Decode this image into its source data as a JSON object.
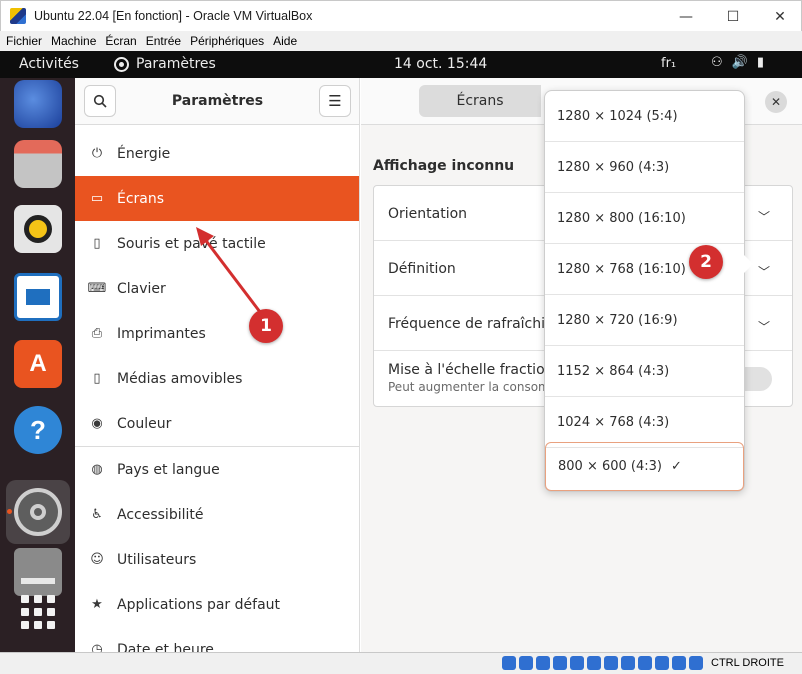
{
  "window": {
    "title": "Ubuntu 22.04 [En fonction] - Oracle VM VirtualBox",
    "minimize": "—",
    "maximize": "☐",
    "close": "✕"
  },
  "vbox_menu": [
    "Fichier",
    "Machine",
    "Écran",
    "Entrée",
    "Périphériques",
    "Aide"
  ],
  "topbar": {
    "activities": "Activités",
    "app": "Paramètres",
    "clock": "14 oct.  15:44",
    "keyboard": "fr₁"
  },
  "sidebar": {
    "title": "Paramètres",
    "items": [
      {
        "label": "Énergie",
        "icon": "power-icon"
      },
      {
        "label": "Écrans",
        "icon": "display-icon"
      },
      {
        "label": "Souris et pavé tactile",
        "icon": "mouse-icon"
      },
      {
        "label": "Clavier",
        "icon": "keyboard-icon"
      },
      {
        "label": "Imprimantes",
        "icon": "printer-icon"
      },
      {
        "label": "Médias amovibles",
        "icon": "usb-icon"
      },
      {
        "label": "Couleur",
        "icon": "color-icon"
      },
      {
        "label": "Pays et langue",
        "icon": "globe-icon"
      },
      {
        "label": "Accessibilité",
        "icon": "accessibility-icon"
      },
      {
        "label": "Utilisateurs",
        "icon": "users-icon"
      },
      {
        "label": "Applications par défaut",
        "icon": "star-icon"
      },
      {
        "label": "Date et heure",
        "icon": "clock-icon"
      }
    ]
  },
  "main": {
    "tab": "Écrans",
    "section_title": "Affichage inconnu",
    "rows": {
      "orientation": "Orientation",
      "definition": "Définition",
      "refresh": "Fréquence de rafraîchis",
      "scaling": "Mise à l'échelle fraction",
      "scaling_sub": "Peut augmenter la consomm"
    }
  },
  "dropdown": {
    "options": [
      "1280 × 1024 (5:4)",
      "1280 × 960 (4:3)",
      "1280 × 800 (16:10)",
      "1280 × 768 (16:10)",
      "1280 × 720 (16:9)",
      "1152 × 864 (4:3)",
      "1024 × 768 (4:3)",
      "800 × 600 (4:3)"
    ],
    "selected_check": "✓"
  },
  "annotations": {
    "step1": "1",
    "step2": "2"
  },
  "statusbar": {
    "host_key": "CTRL DROITE"
  },
  "colors": {
    "accent": "#e95420",
    "badge": "#d32f2f",
    "dock": "#2b2024"
  }
}
